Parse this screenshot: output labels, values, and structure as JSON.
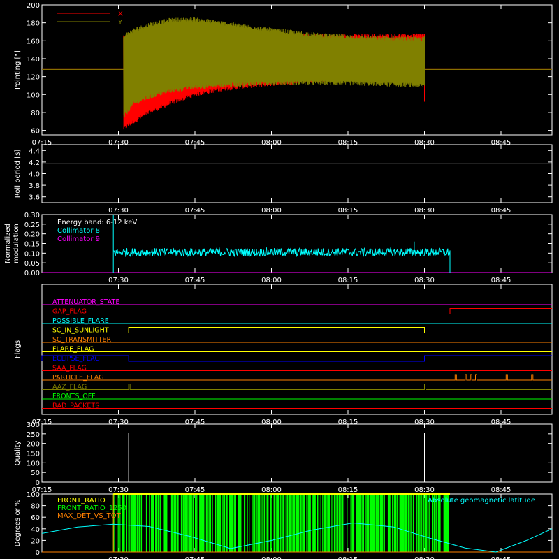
{
  "chart_data": [
    {
      "type": "line",
      "ylabel": "Pointing [\"]",
      "xlim": [
        "07:15",
        "08:55"
      ],
      "ylim": [
        55,
        200
      ],
      "yticks": [
        60,
        80,
        100,
        120,
        140,
        160,
        180,
        200
      ],
      "xticks": [
        "07:15",
        "07:30",
        "07:45",
        "08:00",
        "08:15",
        "08:30",
        "08:45"
      ],
      "legend": "top-left",
      "series": [
        {
          "name": "X",
          "color": "#ff0000",
          "baseline": 128,
          "band_time": [
            "07:31",
            "07:33",
            "07:36",
            "07:40",
            "07:45",
            "07:50",
            "08:00",
            "08:10",
            "08:20",
            "08:30"
          ],
          "band_min": [
            62,
            70,
            80,
            90,
            100,
            106,
            112,
            116,
            118,
            120
          ],
          "band_max": [
            165,
            160,
            158,
            160,
            163,
            165,
            165,
            165,
            165,
            166
          ]
        },
        {
          "name": "Y",
          "color": "#808000",
          "baseline": 128,
          "band_time": [
            "07:31",
            "07:33",
            "07:36",
            "07:40",
            "07:45",
            "07:50",
            "08:00",
            "08:10",
            "08:20",
            "08:30"
          ],
          "band_min": [
            75,
            90,
            97,
            104,
            108,
            110,
            113,
            113,
            112,
            110
          ],
          "band_max": [
            165,
            172,
            178,
            183,
            184,
            180,
            172,
            166,
            163,
            162
          ]
        }
      ]
    },
    {
      "type": "line",
      "ylabel": "Roll period [s]",
      "ylim": [
        3.5,
        4.5
      ],
      "yticks": [
        "3.6",
        "3.8",
        "4.0",
        "4.2",
        "4.4"
      ],
      "xticks": [
        "07:30",
        "07:45",
        "08:00",
        "08:15",
        "08:30",
        "08:45"
      ],
      "series": [
        {
          "name": "",
          "color": "#ffffff",
          "x": [
            "07:15",
            "08:55"
          ],
          "values": [
            4.17,
            4.17
          ]
        }
      ]
    },
    {
      "type": "line",
      "ylabel": "Normalized modulation",
      "ylim": [
        0,
        0.3
      ],
      "yticks": [
        "0.00",
        "0.05",
        "0.10",
        "0.15",
        "0.20",
        "0.25",
        "0.30"
      ],
      "xticks": [
        "07:30",
        "07:45",
        "08:00",
        "08:15",
        "08:30",
        "08:45"
      ],
      "annotation": "Energy band: 6-12 keV",
      "series": [
        {
          "name": "Collimator 8",
          "color": "#00ffff",
          "start": "07:29",
          "end": "08:35",
          "mean": 0.105,
          "noise": 0.012,
          "spikes": [
            {
              "x": "08:28",
              "y": 0.16
            }
          ]
        },
        {
          "name": "Collimator 9",
          "color": "#ff00ff",
          "x": [
            "07:15",
            "08:55"
          ],
          "values": [
            0,
            0
          ]
        }
      ]
    },
    {
      "type": "table",
      "ylabel": "Flags",
      "xticks": [
        "07:15",
        "07:30",
        "07:45",
        "08:00",
        "08:15",
        "08:30",
        "08:45"
      ],
      "flags": [
        {
          "name": "ATTENUATOR_STATE",
          "color": "#ff00ff",
          "segments": []
        },
        {
          "name": "GAP_FLAG",
          "color": "#ff0000",
          "segments": [
            {
              "start": "08:35",
              "end": "08:55"
            }
          ]
        },
        {
          "name": "POSSIBLE_FLARE",
          "color": "#00ffff",
          "segments": []
        },
        {
          "name": "SC_IN_SUNLIGHT",
          "color": "#ffff00",
          "segments": [
            {
              "start": "07:32",
              "end": "08:30"
            }
          ]
        },
        {
          "name": "SC_TRANSMITTER",
          "color": "#ff8000",
          "segments": []
        },
        {
          "name": "FLARE_FLAG",
          "color": "#ffff00",
          "segments": []
        },
        {
          "name": "ECLIPSE_FLAG",
          "color": "#0000ff",
          "segments": [
            {
              "start": "07:15",
              "end": "07:32"
            },
            {
              "start": "08:30",
              "end": "08:55"
            }
          ]
        },
        {
          "name": "SAA_FLAG",
          "color": "#ff0000",
          "segments": []
        },
        {
          "name": "PARTICLE_FLAG",
          "color": "#ff8000",
          "spikes": [
            "08:36",
            "08:38",
            "08:39",
            "08:40",
            "08:46",
            "08:51"
          ]
        },
        {
          "name": "AAZ_FLAG",
          "color": "#808000",
          "spikes": [
            "07:32",
            "08:30"
          ]
        },
        {
          "name": "FRONTS_OFF",
          "color": "#00ff00",
          "segments": []
        },
        {
          "name": "BAD_PACKETS",
          "color": "#ff0000",
          "segments": []
        }
      ]
    },
    {
      "type": "line",
      "ylabel": "Quality",
      "ylim": [
        0,
        300
      ],
      "yticks": [
        "0",
        "50",
        "100",
        "150",
        "200",
        "250",
        "300"
      ],
      "xticks": [
        "07:15",
        "07:30",
        "07:45",
        "08:00",
        "08:15",
        "08:30",
        "08:45"
      ],
      "series": [
        {
          "name": "",
          "color": "#ffffff",
          "x": [
            "07:15",
            "07:32",
            "07:32",
            "08:30",
            "08:30",
            "08:55"
          ],
          "values": [
            255,
            255,
            0,
            0,
            255,
            255
          ]
        }
      ]
    },
    {
      "type": "line",
      "ylabel": "Degrees or %",
      "ylim": [
        0,
        100
      ],
      "yticks": [
        "0",
        "20",
        "40",
        "60",
        "80",
        "100"
      ],
      "xticks": [
        "07:30",
        "07:45",
        "08:00",
        "08:15",
        "08:30",
        "08:45"
      ],
      "series": [
        {
          "name": "FRONT_RATIO",
          "color": "#ffff00",
          "start": "07:29",
          "end": "08:35",
          "value": 100
        },
        {
          "name": "FRONT_RATIO_1250",
          "color": "#00ff00",
          "start": "07:29",
          "end": "08:35",
          "bars": "dense"
        },
        {
          "name": "MAX_DET_VS_TOT",
          "color": "#ff8000",
          "x": [
            "07:15",
            "08:55"
          ],
          "values": [
            0,
            0
          ]
        },
        {
          "name": "Absolute geomagnetic latitude",
          "color": "#00ffff",
          "x": [
            "07:15",
            "07:22",
            "07:29",
            "07:36",
            "07:44",
            "07:52",
            "08:00",
            "08:08",
            "08:16",
            "08:24",
            "08:31",
            "08:38",
            "08:44",
            "08:50",
            "08:55"
          ],
          "values": [
            32,
            43,
            48,
            44,
            27,
            6,
            20,
            38,
            50,
            43,
            24,
            7,
            0,
            20,
            40
          ]
        }
      ]
    }
  ]
}
